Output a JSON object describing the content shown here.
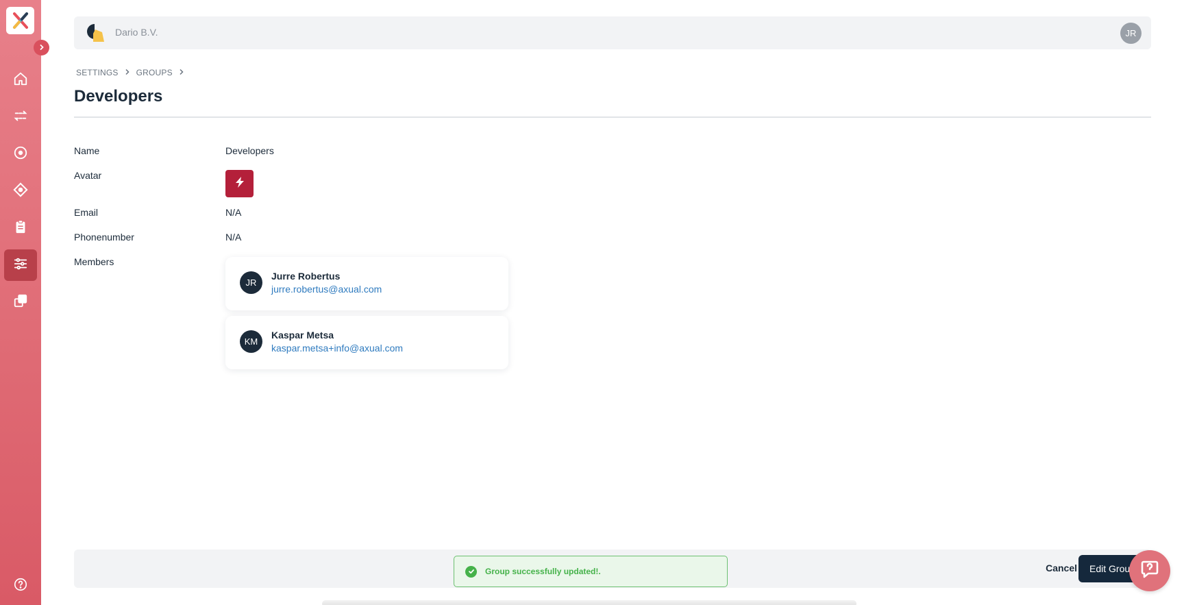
{
  "sidebar": {
    "logo_icon": "axual-x-logo-icon",
    "expand_icon": "chevron-right-icon",
    "items": [
      {
        "icon": "home-icon",
        "active": false
      },
      {
        "icon": "streams-transfer-icon",
        "active": false
      },
      {
        "icon": "target-icon",
        "active": false
      },
      {
        "icon": "diamond-icon",
        "active": false
      },
      {
        "icon": "clipboard-icon",
        "active": false
      },
      {
        "icon": "settings-sliders-icon",
        "active": true
      },
      {
        "icon": "copy-icon",
        "active": false
      }
    ],
    "help_icon": "question-circle-icon",
    "colors": {
      "top": "#e8808a",
      "bottom": "#d95a66",
      "active": "#b8404a"
    }
  },
  "header": {
    "org_name": "Dario B.V.",
    "user_initials": "JR"
  },
  "breadcrumb": [
    "SETTINGS",
    "GROUPS"
  ],
  "page_title": "Developers",
  "details": {
    "name_label": "Name",
    "name_value": "Developers",
    "avatar_label": "Avatar",
    "avatar_icon": "lightning-bolt-icon",
    "avatar_color": "#b4203a",
    "email_label": "Email",
    "email_value": "N/A",
    "phone_label": "Phonenumber",
    "phone_value": "N/A",
    "members_label": "Members"
  },
  "members": [
    {
      "initials": "JR",
      "name": "Jurre Robertus",
      "email": "jurre.robertus@axual.com"
    },
    {
      "initials": "KM",
      "name": "Kaspar Metsa",
      "email": "kaspar.metsa+info@axual.com"
    }
  ],
  "actions": {
    "cancel_label": "Cancel",
    "edit_label": "Edit Group"
  },
  "toast": {
    "message": "Group successfully updated!.",
    "icon": "check-circle-icon",
    "color": "#45b24a"
  },
  "help_fab_icon": "chat-support-icon"
}
